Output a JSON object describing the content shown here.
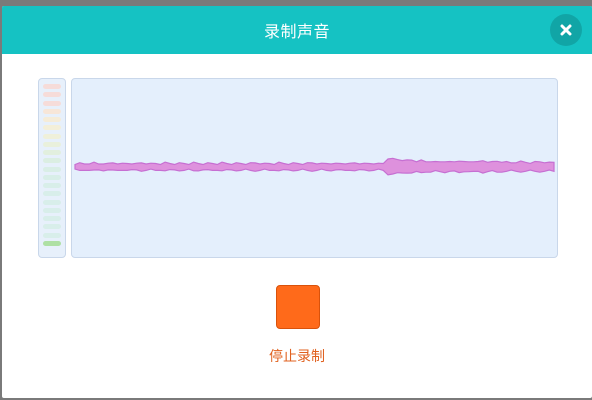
{
  "dialog": {
    "title": "录制声音",
    "close_icon": "close-icon",
    "stop_label": "停止录制"
  },
  "meter": {
    "levels": [
      "#f6dcd9",
      "#f6dcd9",
      "#f6dcd9",
      "#f7e6d8",
      "#f5ecd8",
      "#f3efd9",
      "#eff0da",
      "#e9f0dc",
      "#e2efde",
      "#dbeee2",
      "#d9eee6",
      "#d8eee8",
      "#d8eee9",
      "#d8eeea",
      "#d8eeea",
      "#d8eeea",
      "#d8eeea",
      "#d8eeea",
      "#d8eeea",
      "#aee0a4"
    ],
    "active_count": 1
  },
  "waveform": {
    "fill": "#de91dd",
    "stroke": "#c66fd2",
    "amplitudes": [
      6,
      7,
      6,
      7,
      8,
      6,
      7,
      6,
      8,
      7,
      6,
      7,
      7,
      6,
      8,
      7,
      6,
      7,
      6,
      8,
      7,
      6,
      7,
      7,
      6,
      8,
      7,
      6,
      7,
      7,
      6,
      8,
      7,
      6,
      7,
      7,
      6,
      7,
      8,
      7,
      6,
      7,
      6,
      8,
      7,
      6,
      7,
      7,
      6,
      7,
      8,
      7,
      6,
      7,
      7,
      6,
      7,
      7,
      6,
      8,
      7,
      6,
      7,
      7,
      6,
      7,
      16,
      15,
      14,
      13,
      12,
      13,
      11,
      12,
      10,
      11,
      9,
      10,
      11,
      9,
      10,
      12,
      9,
      10,
      11,
      9,
      12,
      10,
      9,
      11,
      10,
      9,
      8,
      9,
      10,
      9,
      8,
      9,
      10,
      9,
      8,
      9
    ]
  },
  "colors": {
    "header": "#15c2c3",
    "stop_button": "#ff6a1a",
    "stop_text": "#e0611f"
  }
}
